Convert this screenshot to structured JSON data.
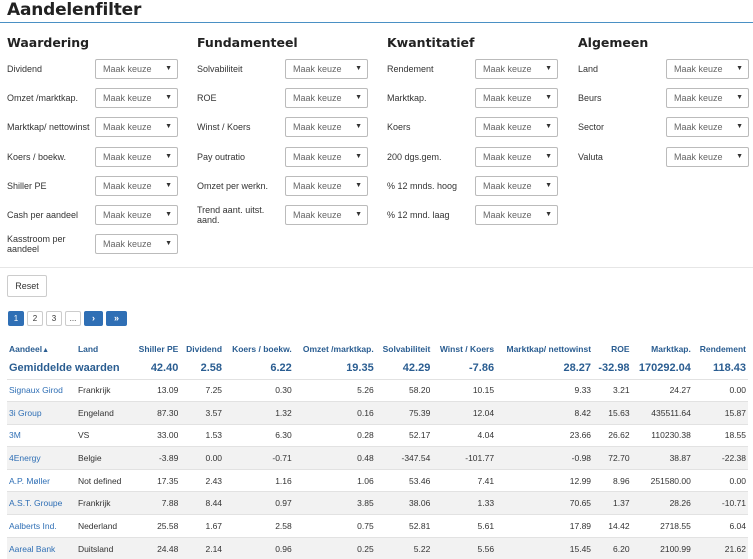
{
  "title": "Aandelenfilter",
  "placeholder": "Maak keuze",
  "filters": [
    {
      "heading": "Waardering",
      "fields": [
        "Dividend",
        "Omzet /marktkap.",
        "Marktkap/ nettowinst",
        "Koers / boekw.",
        "Shiller PE",
        "Cash per aandeel",
        "Kasstroom per aandeel"
      ]
    },
    {
      "heading": "Fundamenteel",
      "fields": [
        "Solvabiliteit",
        "ROE",
        "Winst / Koers",
        "Pay outratio",
        "Omzet per werkn.",
        "Trend aant. uitst. aand."
      ]
    },
    {
      "heading": "Kwantitatief",
      "fields": [
        "Rendement",
        "Marktkap.",
        "Koers",
        "200 dgs.gem.",
        "% 12 mnds. hoog",
        "% 12 mnd. laag"
      ]
    },
    {
      "heading": "Algemeen",
      "fields": [
        "Land",
        "Beurs",
        "Sector",
        "Valuta"
      ]
    }
  ],
  "reset_label": "Reset",
  "pager": {
    "pages": [
      "1",
      "2",
      "3",
      "..."
    ],
    "next": "›",
    "last": "»",
    "active": "1"
  },
  "table": {
    "headers": [
      "Aandeel",
      "Land",
      "Shiller PE",
      "Dividend",
      "Koers / boekw.",
      "Omzet /marktkap.",
      "Solvabiliteit",
      "Winst / Koers",
      "Marktkap/ nettowinst",
      "ROE",
      "Marktkap.",
      "Rendement"
    ],
    "sort_indicator": "▲",
    "average": [
      "Gemiddelde waarden",
      "",
      "42.40",
      "2.58",
      "6.22",
      "19.35",
      "42.29",
      "-7.86",
      "28.27",
      "-32.98",
      "170292.04",
      "118.43"
    ],
    "rows": [
      [
        "Signaux Girod",
        "Frankrijk",
        "13.09",
        "7.25",
        "0.30",
        "5.26",
        "58.20",
        "10.15",
        "9.33",
        "3.21",
        "24.27",
        "0.00"
      ],
      [
        "3i Group",
        "Engeland",
        "87.30",
        "3.57",
        "1.32",
        "0.16",
        "75.39",
        "12.04",
        "8.42",
        "15.63",
        "435511.64",
        "15.87"
      ],
      [
        "3M",
        "VS",
        "33.00",
        "1.53",
        "6.30",
        "0.28",
        "52.17",
        "4.04",
        "23.66",
        "26.62",
        "110230.38",
        "18.55"
      ],
      [
        "4Energy",
        "Belgie",
        "-3.89",
        "0.00",
        "-0.71",
        "0.48",
        "-347.54",
        "-101.77",
        "-0.98",
        "72.70",
        "38.87",
        "-22.38"
      ],
      [
        "A.P. Møller",
        "Not defined",
        "17.35",
        "2.43",
        "1.16",
        "1.06",
        "53.46",
        "7.41",
        "12.99",
        "8.96",
        "251580.00",
        "0.00"
      ],
      [
        "A.S.T. Groupe",
        "Frankrijk",
        "7.88",
        "8.44",
        "0.97",
        "3.85",
        "38.06",
        "1.33",
        "70.65",
        "1.37",
        "28.26",
        "-10.71"
      ],
      [
        "Aalberts Ind.",
        "Nederland",
        "25.58",
        "1.67",
        "2.58",
        "0.75",
        "52.81",
        "5.61",
        "17.89",
        "14.42",
        "2718.55",
        "6.04"
      ],
      [
        "Aareal Bank",
        "Duitsland",
        "24.48",
        "2.14",
        "0.96",
        "0.25",
        "5.22",
        "5.56",
        "15.45",
        "6.20",
        "2100.99",
        "21.62"
      ]
    ]
  }
}
